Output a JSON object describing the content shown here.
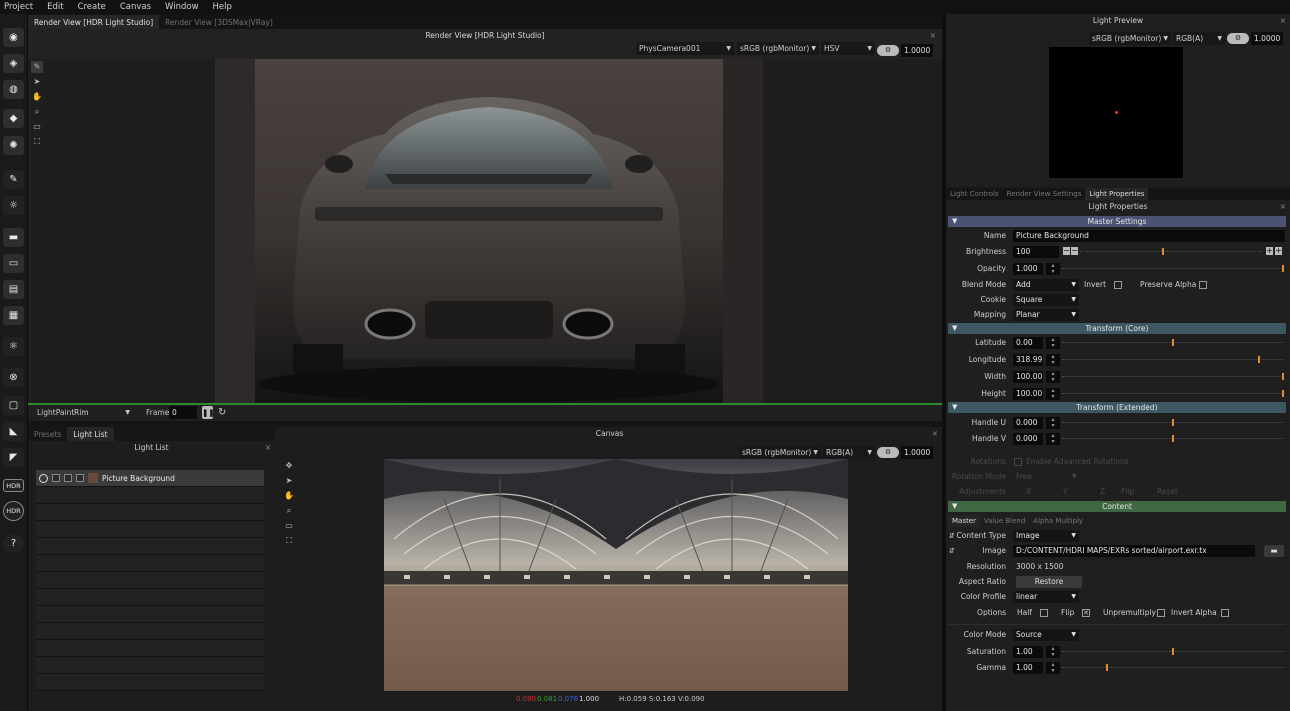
{
  "menu": [
    "Project",
    "Edit",
    "Create",
    "Canvas",
    "Window",
    "Help"
  ],
  "render_view": {
    "tabs": [
      "Render View [HDR Light Studio]",
      "Render View [3DSMax|VRay]"
    ],
    "title": "Render View [HDR Light Studio]",
    "camera": "PhysCamera001",
    "color_space": "sRGB (rgbMonitor)",
    "channel": "HSV",
    "exposure": "1.0000",
    "lightpaint_label": "LightPaint",
    "lightpaint_mode": "Rim",
    "frame_label": "Frame",
    "frame_value": "0"
  },
  "light_list": {
    "tabs": [
      "Presets",
      "Light List"
    ],
    "title": "Light List",
    "items": [
      "Picture Background"
    ]
  },
  "canvas": {
    "title": "Canvas",
    "color_space": "sRGB (rgbMonitor)",
    "channel": "RGB(A)",
    "exposure": "1.0000",
    "status_r": "0.090",
    "status_g": "0.081",
    "status_b": "0.076",
    "status_a": "1.000",
    "status_hsv": "H:0.059 S:0.163 V:0.090"
  },
  "light_preview": {
    "title": "Light Preview",
    "color_space": "sRGB (rgbMonitor)",
    "channel": "RGB(A)",
    "exposure": "1.0000"
  },
  "props": {
    "tabs": [
      "Light Controls",
      "Render View Settings",
      "Light Properties"
    ],
    "title": "Light Properties",
    "master_section": "Master Settings",
    "name_label": "Name",
    "name_value": "Picture Background",
    "brightness_label": "Brightness",
    "brightness_value": "100",
    "brightness_level": 0.45,
    "opacity_label": "Opacity",
    "opacity_value": "1.000",
    "blend_label": "Blend Mode",
    "blend_value": "Add",
    "invert_label": "Invert",
    "preserve_alpha_label": "Preserve Alpha",
    "cookie_label": "Cookie",
    "cookie_value": "Square",
    "mapping_label": "Mapping",
    "mapping_value": "Planar",
    "transform_core_section": "Transform (Core)",
    "latitude_label": "Latitude",
    "latitude_value": "0.00",
    "longitude_label": "Longitude",
    "longitude_value": "318.99",
    "width_label": "Width",
    "width_value": "100.00",
    "height_label": "Height",
    "height_value": "100.00",
    "transform_ext_section": "Transform (Extended)",
    "handle_u_label": "Handle U",
    "handle_u_value": "0.000",
    "handle_v_label": "Handle V",
    "handle_v_value": "0.000",
    "rotations_label": "Rotations",
    "rotations_check": "Enable Advanced Rotations",
    "rotation_mode_label": "Rotation Mode",
    "rotation_mode_value": "Free",
    "adjustments_label": "Adjustments",
    "adj_x": "X",
    "adj_y": "Y",
    "adj_z": "Z",
    "flip_label": "Flip",
    "reset_label": "Reset",
    "content_section": "Content",
    "content_tabs": [
      "Master",
      "Value Blend",
      "Alpha Multiply"
    ],
    "content_type_label": "Content Type",
    "content_type_value": "Image",
    "image_label": "Image",
    "image_value": "D:/CONTENT/HDRI MAPS/EXRs sorted/airport.exr.tx",
    "resolution_label": "Resolution",
    "resolution_value": "3000 x 1500",
    "aspect_label": "Aspect Ratio",
    "restore_label": "Restore",
    "color_profile_label": "Color Profile",
    "color_profile_value": "linear",
    "options_label": "Options",
    "half_label": "Half",
    "flip_opt_label": "Flip",
    "unpremultiply_label": "Unpremultiply",
    "invert_alpha_label": "Invert Alpha",
    "color_mode_label": "Color Mode",
    "color_mode_value": "Source",
    "saturation_label": "Saturation",
    "saturation_value": "1.00",
    "gamma_label": "Gamma",
    "gamma_value": "1.00"
  },
  "colors": {
    "master_header": "#4b5272",
    "transform_header": "#3d5863",
    "content_header": "#406742",
    "slider_knob": "#e08a2a",
    "lightpaint_line": "#2f8a2f"
  }
}
